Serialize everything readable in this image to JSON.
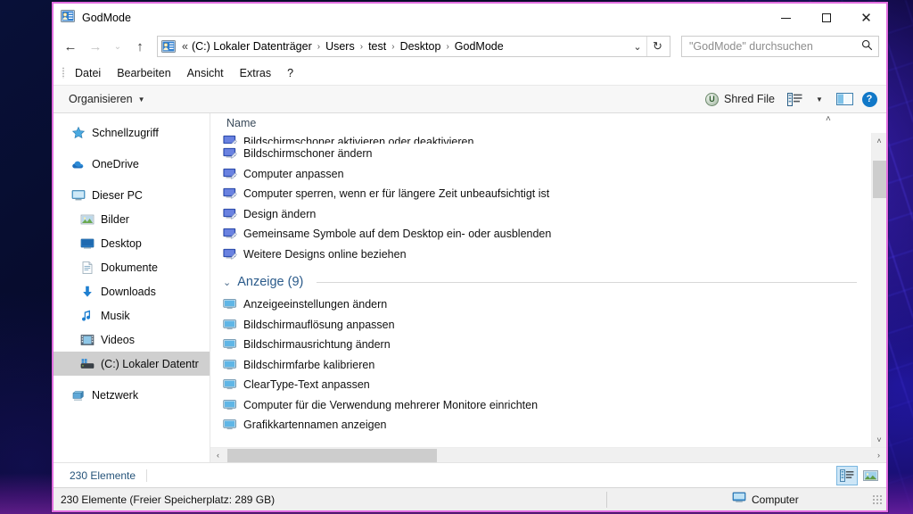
{
  "window": {
    "title": "GodMode",
    "title_icon": "godmode-control-panel-icon",
    "minimize": "—",
    "maximize": "☐",
    "close": "✕"
  },
  "addressbar": {
    "back_icon": "←",
    "forward_icon": "→",
    "recent_icon": "⌄",
    "up_icon": "↑",
    "path_icon": "godmode-control-panel-icon",
    "lead": "«",
    "crumbs": [
      "(C:) Lokaler Datenträger",
      "Users",
      "test",
      "Desktop",
      "GodMode"
    ],
    "separator": "›",
    "dropdown_icon": "⌄",
    "refresh_icon": "↻"
  },
  "search": {
    "placeholder": "\"GodMode\" durchsuchen",
    "icon": "search-icon"
  },
  "menubar": {
    "items": [
      "Datei",
      "Bearbeiten",
      "Ansicht",
      "Extras",
      "?"
    ]
  },
  "commandbar": {
    "organize_label": "Organisieren",
    "organize_caret": "▼",
    "shred_label": "Shred File",
    "shred_badge": "U",
    "layout_caret": "▼",
    "preview_pane_icon": "preview-pane-icon",
    "help_label": "?"
  },
  "sidebar": {
    "items": [
      {
        "label": "Schnellzugriff",
        "icon": "star-icon",
        "indent": false,
        "selected": false
      },
      {
        "label": "OneDrive",
        "icon": "cloud-icon",
        "indent": false,
        "selected": false
      },
      {
        "label": "Dieser PC",
        "icon": "monitor-icon",
        "indent": false,
        "selected": false
      },
      {
        "label": "Bilder",
        "icon": "pictures-icon",
        "indent": true,
        "selected": false
      },
      {
        "label": "Desktop",
        "icon": "desktop-icon",
        "indent": true,
        "selected": false
      },
      {
        "label": "Dokumente",
        "icon": "documents-icon",
        "indent": true,
        "selected": false
      },
      {
        "label": "Downloads",
        "icon": "download-arrow-icon",
        "indent": true,
        "selected": false
      },
      {
        "label": "Musik",
        "icon": "music-note-icon",
        "indent": true,
        "selected": false
      },
      {
        "label": "Videos",
        "icon": "video-film-icon",
        "indent": true,
        "selected": false
      },
      {
        "label": "(C:) Lokaler Datentr",
        "icon": "hard-drive-icon",
        "indent": true,
        "selected": true
      },
      {
        "label": "Netzwerk",
        "icon": "network-icon",
        "indent": false,
        "selected": false
      }
    ]
  },
  "list": {
    "column_header": "Name",
    "sort_chevron": "˄",
    "rows_top": [
      {
        "label": "Bildschirmschoner aktivieren oder deaktivieren",
        "icon": "personalization-icon",
        "clipped": true
      },
      {
        "label": "Bildschirmschoner ändern",
        "icon": "personalization-icon",
        "clipped": false
      },
      {
        "label": "Computer anpassen",
        "icon": "personalization-icon",
        "clipped": false
      },
      {
        "label": "Computer sperren, wenn er für längere Zeit unbeaufsichtigt ist",
        "icon": "personalization-icon",
        "clipped": false
      },
      {
        "label": "Design ändern",
        "icon": "personalization-icon",
        "clipped": false
      },
      {
        "label": "Gemeinsame Symbole auf dem Desktop ein- oder ausblenden",
        "icon": "personalization-icon",
        "clipped": false
      },
      {
        "label": "Weitere Designs online beziehen",
        "icon": "personalization-icon",
        "clipped": false
      }
    ],
    "group": {
      "chevron": "⌄",
      "title": "Anzeige (9)"
    },
    "rows_group": [
      {
        "label": "Anzeigeeinstellungen ändern",
        "icon": "display-icon",
        "clipped": false
      },
      {
        "label": "Bildschirmauflösung anpassen",
        "icon": "display-icon",
        "clipped": false
      },
      {
        "label": "Bildschirmausrichtung ändern",
        "icon": "display-icon",
        "clipped": false
      },
      {
        "label": "Bildschirmfarbe kalibrieren",
        "icon": "display-icon",
        "clipped": false
      },
      {
        "label": "ClearType-Text anpassen",
        "icon": "display-icon",
        "clipped": false
      },
      {
        "label": "Computer für die Verwendung mehrerer Monitore einrichten",
        "icon": "display-icon",
        "clipped": false
      },
      {
        "label": "Grafikkartennamen anzeigen",
        "icon": "display-icon",
        "clipped": true
      }
    ]
  },
  "scrollbars": {
    "up_arrow": "˄",
    "down_arrow": "˅",
    "left_arrow": "‹",
    "right_arrow": "›"
  },
  "statusbar": {
    "count": "230 Elemente",
    "view_details_icon": "details-view-icon",
    "view_largeicons_icon": "large-icons-view-icon"
  },
  "bottombar": {
    "text": "230 Elemente (Freier Speicherplatz: 289 GB)",
    "target_label": "Computer",
    "target_icon": "computer-icon"
  },
  "colors": {
    "window_border": "#e06de0",
    "accent_blue": "#2a5a8a",
    "selection_gray": "#cfcfcf",
    "status_text": "#26547a"
  }
}
